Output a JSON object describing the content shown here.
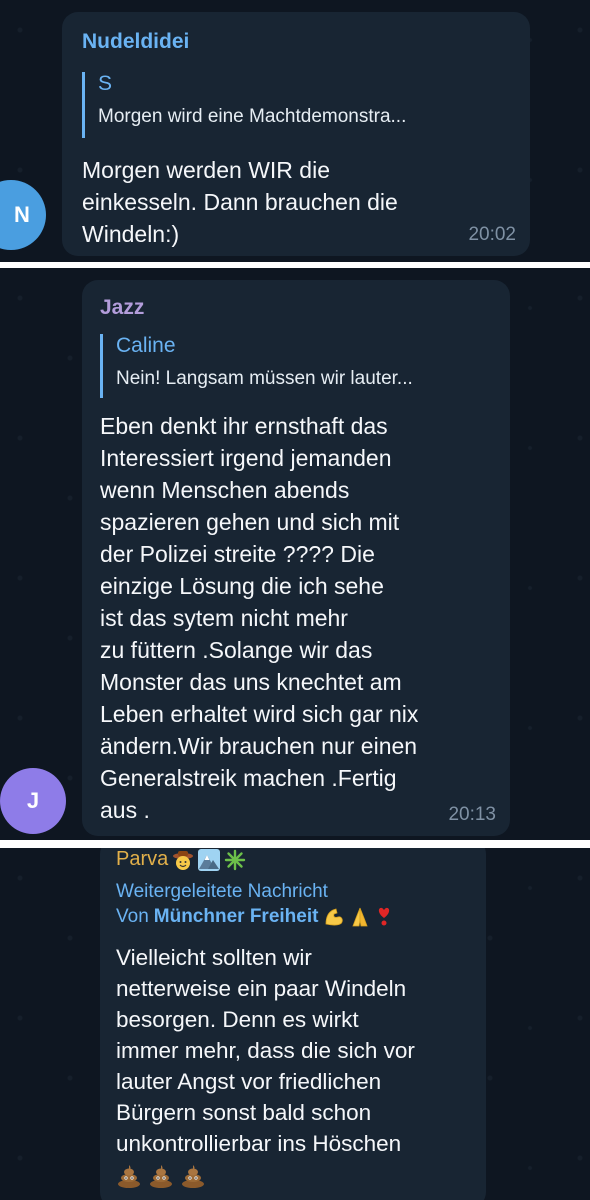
{
  "messages": [
    {
      "sender": "Nudeldidei",
      "sender_color": "#6ab3f3",
      "reply_to": {
        "name": "S",
        "text": "Morgen wird eine Machtdemonstra..."
      },
      "text": "Morgen werden WIR die\neinkesseln. Dann brauchen die\nWindeln:)",
      "time": "20:02",
      "avatar_initial": "N",
      "avatar_color": "#4a9ee0"
    },
    {
      "sender": "Jazz",
      "sender_color": "#b39ddb",
      "reply_to": {
        "name": "Caline",
        "text": "Nein! Langsam müssen wir lauter..."
      },
      "text": "Eben denkt ihr ernsthaft das\nInteressiert irgend jemanden\nwenn Menschen abends\nspazieren gehen und sich mit\nder Polizei streite ???? Die\neinzige Lösung die ich sehe\nist das sytem nicht mehr\nzu füttern  .Solange wir das\nMonster das uns knechtet am\nLeben erhaltet wird sich gar nix\nändern.Wir brauchen nur einen\nGeneralstreik machen .Fertig\naus .",
      "time": "20:13",
      "avatar_initial": "J",
      "avatar_color": "#8e7ce8"
    },
    {
      "sender": "Parva",
      "sender_color": "#e2b04a",
      "sender_emojis": [
        "cowboy-face-emoji",
        "snow-mountain-emoji",
        "sparkle-emoji"
      ],
      "forwarded_label": "Weitergeleitete Nachricht",
      "forwarded_from_prefix": "Von",
      "forwarded_from": "Münchner Freiheit",
      "forwarded_emojis": [
        "flexed-biceps-emoji",
        "folded-hands-emoji",
        "heart-exclamation-emoji"
      ],
      "text": "Vielleicht sollten wir\nnetterweise ein paar Windeln\nbesorgen. Denn es wirkt\nimmer mehr, dass die sich vor\nlauter Angst vor friedlichen\nBürgern sonst bald schon\nunkontrollierbar ins Höschen",
      "trailing_emojis": [
        "pile-of-poo-emoji",
        "pile-of-poo-emoji",
        "pile-of-poo-emoji"
      ]
    }
  ]
}
